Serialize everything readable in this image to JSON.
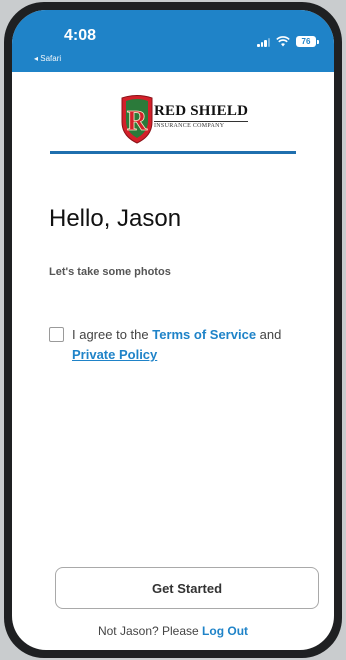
{
  "status_bar": {
    "time": "4:08",
    "back_app": "◂ Safari",
    "battery": "76"
  },
  "logo": {
    "badge_letter": "R",
    "name": "RED SHIELD",
    "subtitle": "INSURANCE COMPANY"
  },
  "main": {
    "greeting": "Hello, Jason",
    "subtitle": "Let's take some photos",
    "agreement": {
      "prefix": "I agree to the ",
      "terms_link": "Terms of Service",
      "middle": " and",
      "privacy_link": "Private Policy",
      "checked": false
    }
  },
  "footer": {
    "start_button": "Get Started",
    "not_user_text": "Not Jason? Please ",
    "logout_link": "Log Out"
  },
  "colors": {
    "accent": "#1f83c8",
    "divider": "#1f6fae",
    "badge_red": "#d3202a",
    "badge_green": "#2b7a3a"
  }
}
